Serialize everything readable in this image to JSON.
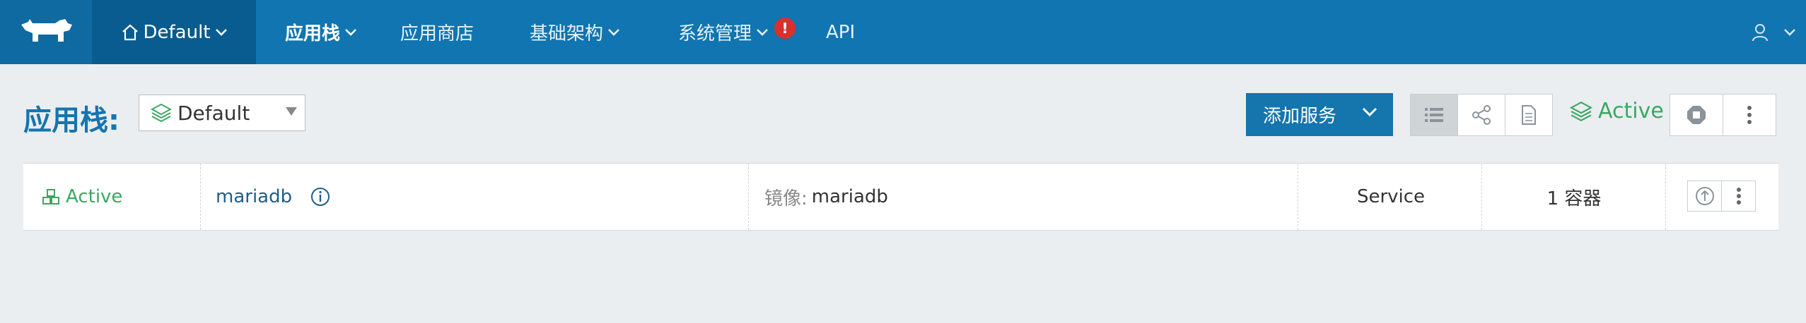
{
  "nav": {
    "environment": "Default",
    "items": [
      {
        "label": "应用栈",
        "has_dropdown": true,
        "active": true
      },
      {
        "label": "应用商店",
        "has_dropdown": false,
        "active": false
      },
      {
        "label": "基础架构",
        "has_dropdown": true,
        "active": false
      },
      {
        "label": "系统管理",
        "has_dropdown": true,
        "active": false,
        "alert": "!"
      },
      {
        "label": "API",
        "has_dropdown": false,
        "active": false
      }
    ]
  },
  "header": {
    "title": "应用栈:",
    "stack_select_value": "Default",
    "add_service_label": "添加服务",
    "stack_state": "Active"
  },
  "services": [
    {
      "state": "Active",
      "name": "mariadb",
      "image_label": "镜像:",
      "image_value": "mariadb",
      "kind": "Service",
      "container_count": "1 容器"
    }
  ],
  "colors": {
    "nav_bg": "#1075b0",
    "env_bg": "#095c8f",
    "primary": "#1575ad",
    "active_green": "#3aa862",
    "alert_red": "#d9302c",
    "page_bg": "#ebeef0"
  }
}
